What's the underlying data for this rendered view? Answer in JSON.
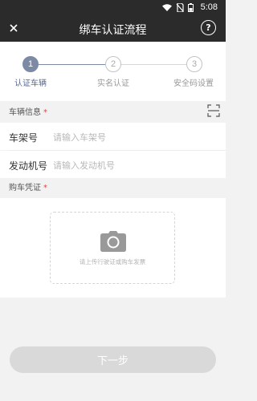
{
  "status_bar": {
    "time": "5:08"
  },
  "title_bar": {
    "title": "绑车认证流程",
    "help_symbol": "?"
  },
  "steps": [
    {
      "number": "1",
      "label": "认证车辆",
      "active": true
    },
    {
      "number": "2",
      "label": "实名认证",
      "active": false
    },
    {
      "number": "3",
      "label": "安全码设置",
      "active": false
    }
  ],
  "vehicle_section": {
    "title": "车辆信息",
    "required_mark": "*",
    "frame_label": "车架号",
    "frame_placeholder": "请输入车架号",
    "engine_label": "发动机号",
    "engine_placeholder": "请输入发动机号"
  },
  "purchase_section": {
    "title": "购车凭证",
    "required_mark": "*",
    "upload_hint": "请上传行驶证或购车发票"
  },
  "next_button": {
    "label": "下一步"
  },
  "colors": {
    "header": "#2b2b2b",
    "step_active": "#7d8aa6",
    "required": "#e04444",
    "button_disabled": "#d9d9d9"
  }
}
